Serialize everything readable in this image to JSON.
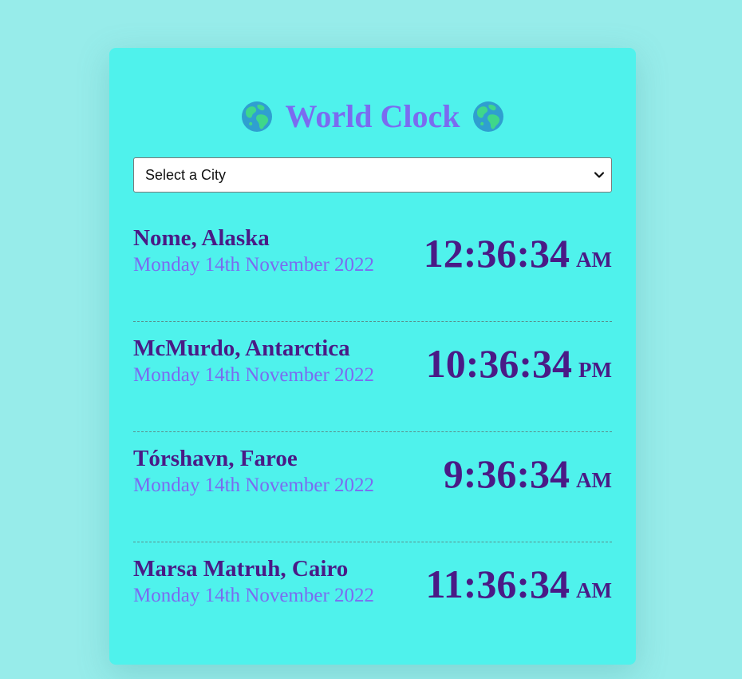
{
  "app": {
    "title": "World Clock",
    "title_icon": "globe-icon"
  },
  "city_select": {
    "value": "Select a City"
  },
  "cities": [
    {
      "name": "Nome, Alaska",
      "date": "Monday 14th November 2022",
      "time": "12:36:34",
      "ampm": "AM"
    },
    {
      "name": "McMurdo, Antarctica",
      "date": "Monday 14th November 2022",
      "time": "10:36:34",
      "ampm": "PM"
    },
    {
      "name": "Tórshavn, Faroe",
      "date": "Monday 14th November 2022",
      "time": "9:36:34",
      "ampm": "AM"
    },
    {
      "name": "Marsa Matruh, Cairo",
      "date": "Monday 14th November 2022",
      "time": "11:36:34",
      "ampm": "AM"
    }
  ],
  "colors": {
    "page_background": "#97ecea",
    "card_background": "#4ff2ec",
    "title_color": "#7b6bf0",
    "city_name_color": "#4a1a86",
    "date_color": "#7b6bf0",
    "time_color": "#4a1a86"
  }
}
